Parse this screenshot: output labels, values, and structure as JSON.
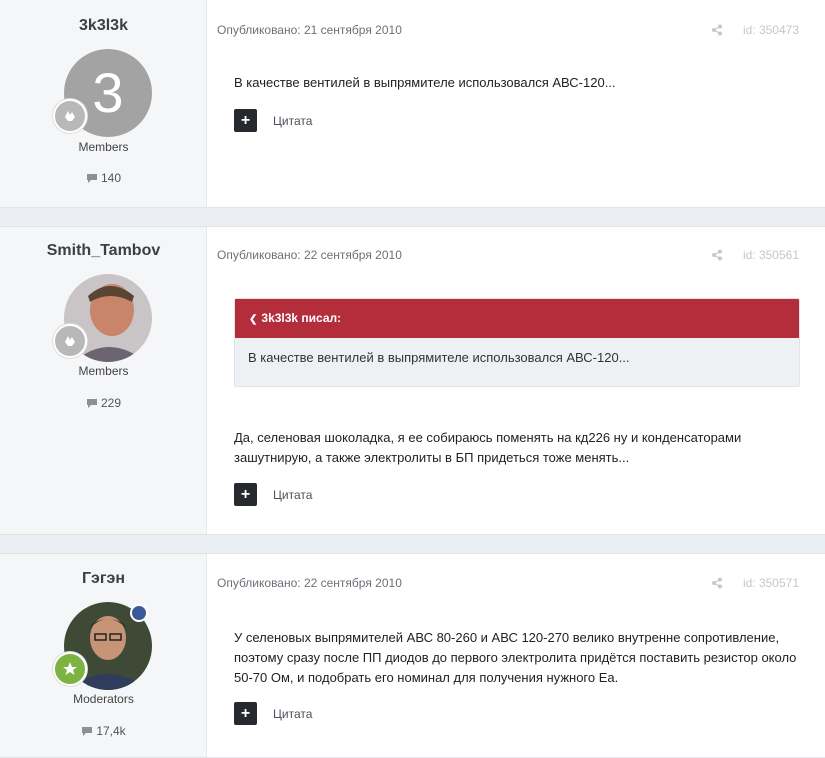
{
  "posts": [
    {
      "author": "3k3l3k",
      "avatar_letter": "3",
      "group": "Members",
      "post_count": "140",
      "published": "Опубликовано: 21 сентября 2010",
      "post_id": "id: 350473",
      "text": "В качестве вентилей в выпрямителе использовался АВС-120...",
      "quote_label": "Цитата"
    },
    {
      "author": "Smith_Tambov",
      "group": "Members",
      "post_count": "229",
      "published": "Опубликовано: 22 сентября 2010",
      "post_id": "id: 350561",
      "quote": {
        "header": "3k3l3k писал:",
        "text": "В качестве вентилей в выпрямителе использовался АВС-120..."
      },
      "text": "Да, селеновая шоколадка, я ее собираюсь поменять на кд226 ну и конденсаторами зашутнирую, а также электролиты в БП придеться тоже менять...",
      "quote_label": "Цитата"
    },
    {
      "author": "Гэгэн",
      "group": "Moderators",
      "post_count": "17,4k",
      "published": "Опубликовано: 22 сентября 2010",
      "post_id": "id: 350571",
      "text": "У селеновых выпрямителей АВС 80-260 и АВС 120-270 велико внутренне сопротивление, поэтому сразу после ПП диодов до первого электролита придётся поставить резистор около 50-70 Ом, и подобрать его номинал для получения нужного Еа.",
      "quote_label": "Цитата"
    }
  ],
  "colors": {
    "quote_header": "#b32d3a",
    "button": "#262a2e",
    "moderator_rank": "#7cb342"
  }
}
